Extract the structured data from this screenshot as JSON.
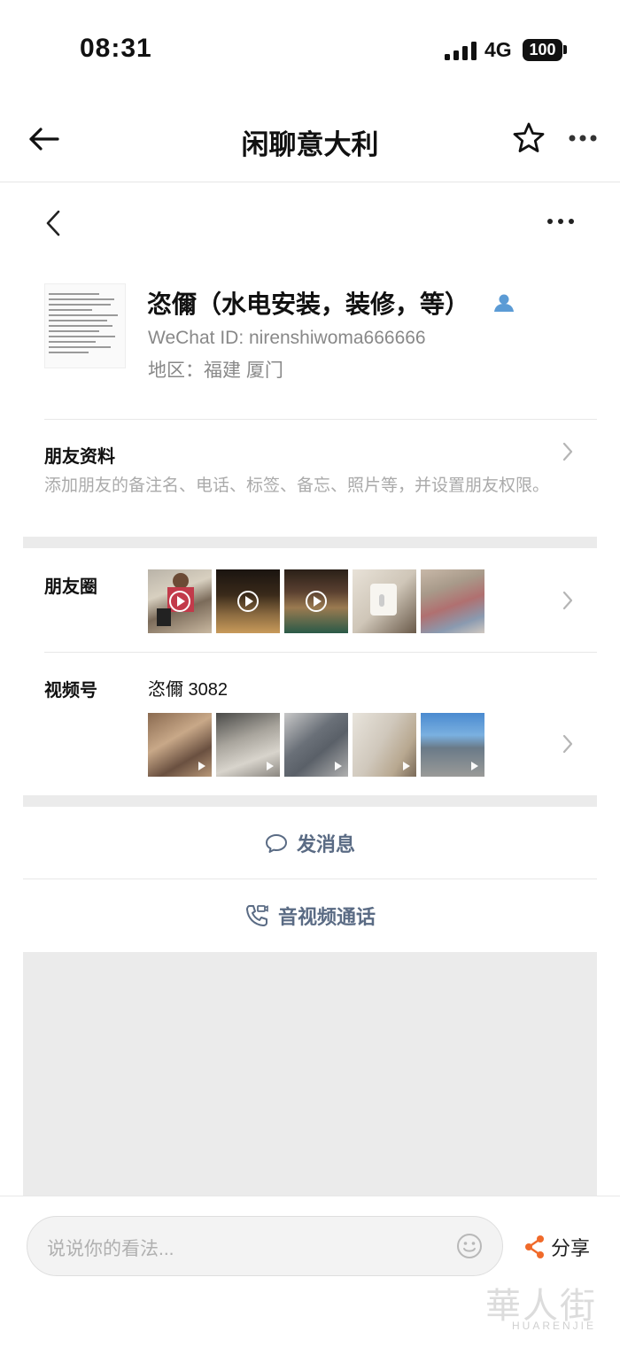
{
  "status_bar": {
    "time": "08:31",
    "network": "4G",
    "battery": "100"
  },
  "nav": {
    "title": "闲聊意大利"
  },
  "profile": {
    "name": "恣儞（水电安装，装修，等）",
    "wechat_id": "WeChat ID: nirenshiwoma666666",
    "region": "地区：福建 厦门"
  },
  "friend_info": {
    "title": "朋友资料",
    "description": "添加朋友的备注名、电话、标签、备忘、照片等，并设置朋友权限。"
  },
  "moments": {
    "title": "朋友圈"
  },
  "channels": {
    "title": "视频号",
    "channel_name": "恣儞 3082"
  },
  "actions": {
    "message": "发消息",
    "call": "音视频通话"
  },
  "bottom_bar": {
    "comment_placeholder": "说说你的看法...",
    "share": "分享"
  },
  "watermark": {
    "brand": "華人街",
    "brand_latin": "HUARENJIE"
  },
  "colors": {
    "accent_blue": "#5a6b84",
    "share_orange": "#f06a2a",
    "person_icon": "#5b9bd5"
  }
}
